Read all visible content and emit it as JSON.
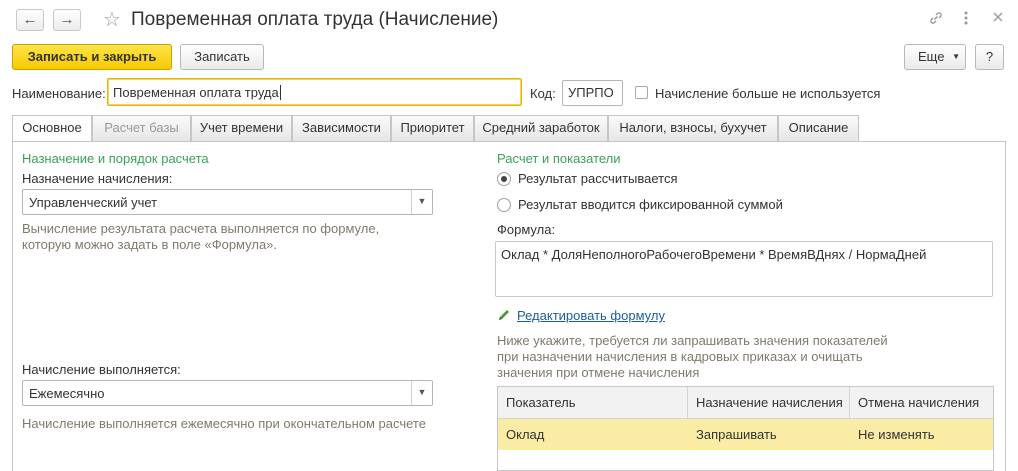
{
  "window": {
    "title": "Повременная оплата труда (Начисление)",
    "back_icon": "arrow-left-icon",
    "forward_icon": "arrow-right-icon",
    "favorite_icon": "star-icon",
    "link_icon": "link-icon",
    "more_icon": "more-vertical-icon",
    "close_icon": "close-icon"
  },
  "toolbar": {
    "save_close_label": "Записать и закрыть",
    "save_label": "Записать",
    "more_label": "Еще",
    "help_label": "?"
  },
  "header": {
    "name_label": "Наименование:",
    "name_value": "Повременная оплата труда",
    "code_label": "Код:",
    "code_value": "УПРПО",
    "unused_label": "Начисление больше не используется"
  },
  "tabs": [
    {
      "label": "Основное"
    },
    {
      "label": "Расчет базы"
    },
    {
      "label": "Учет времени"
    },
    {
      "label": "Зависимости"
    },
    {
      "label": "Приоритет"
    },
    {
      "label": "Средний заработок"
    },
    {
      "label": "Налоги, взносы, бухучет"
    },
    {
      "label": "Описание"
    }
  ],
  "left": {
    "group_title": "Назначение и порядок расчета",
    "purpose_label": "Назначение начисления:",
    "purpose_value": "Управленческий учет",
    "purpose_hint": "Вычисление результата расчета выполняется по формуле, которую можно задать в поле «Формула».",
    "period_label": "Начисление выполняется:",
    "period_value": "Ежемесячно",
    "period_hint": "Начисление выполняется ежемесячно при окончательном расчете"
  },
  "right": {
    "group_title": "Расчет и показатели",
    "radio_calculated": "Результат рассчитывается",
    "radio_fixed": "Результат вводится фиксированной суммой",
    "formula_label": "Формула:",
    "formula_value": "Оклад * ДоляНеполногоРабочегоВремени * ВремяВДнях / НормаДней",
    "edit_formula_link": "Редактировать формулу",
    "indicators_hint": "Ниже укажите, требуется ли запрашивать значения показателей при назначении начисления в кадровых приказах и очищать значения при отмене начисления",
    "table": {
      "columns": [
        "Показатель",
        "Назначение начисления",
        "Отмена начисления"
      ],
      "rows": [
        {
          "indicator": "Оклад",
          "on_assign": "Запрашивать",
          "on_cancel": "Не изменять"
        }
      ]
    }
  },
  "colors": {
    "accent_yellow": "#f7c900",
    "group_green": "#3aa15a",
    "link_blue": "#1b5e9e",
    "selected_row": "#fbeca5"
  }
}
